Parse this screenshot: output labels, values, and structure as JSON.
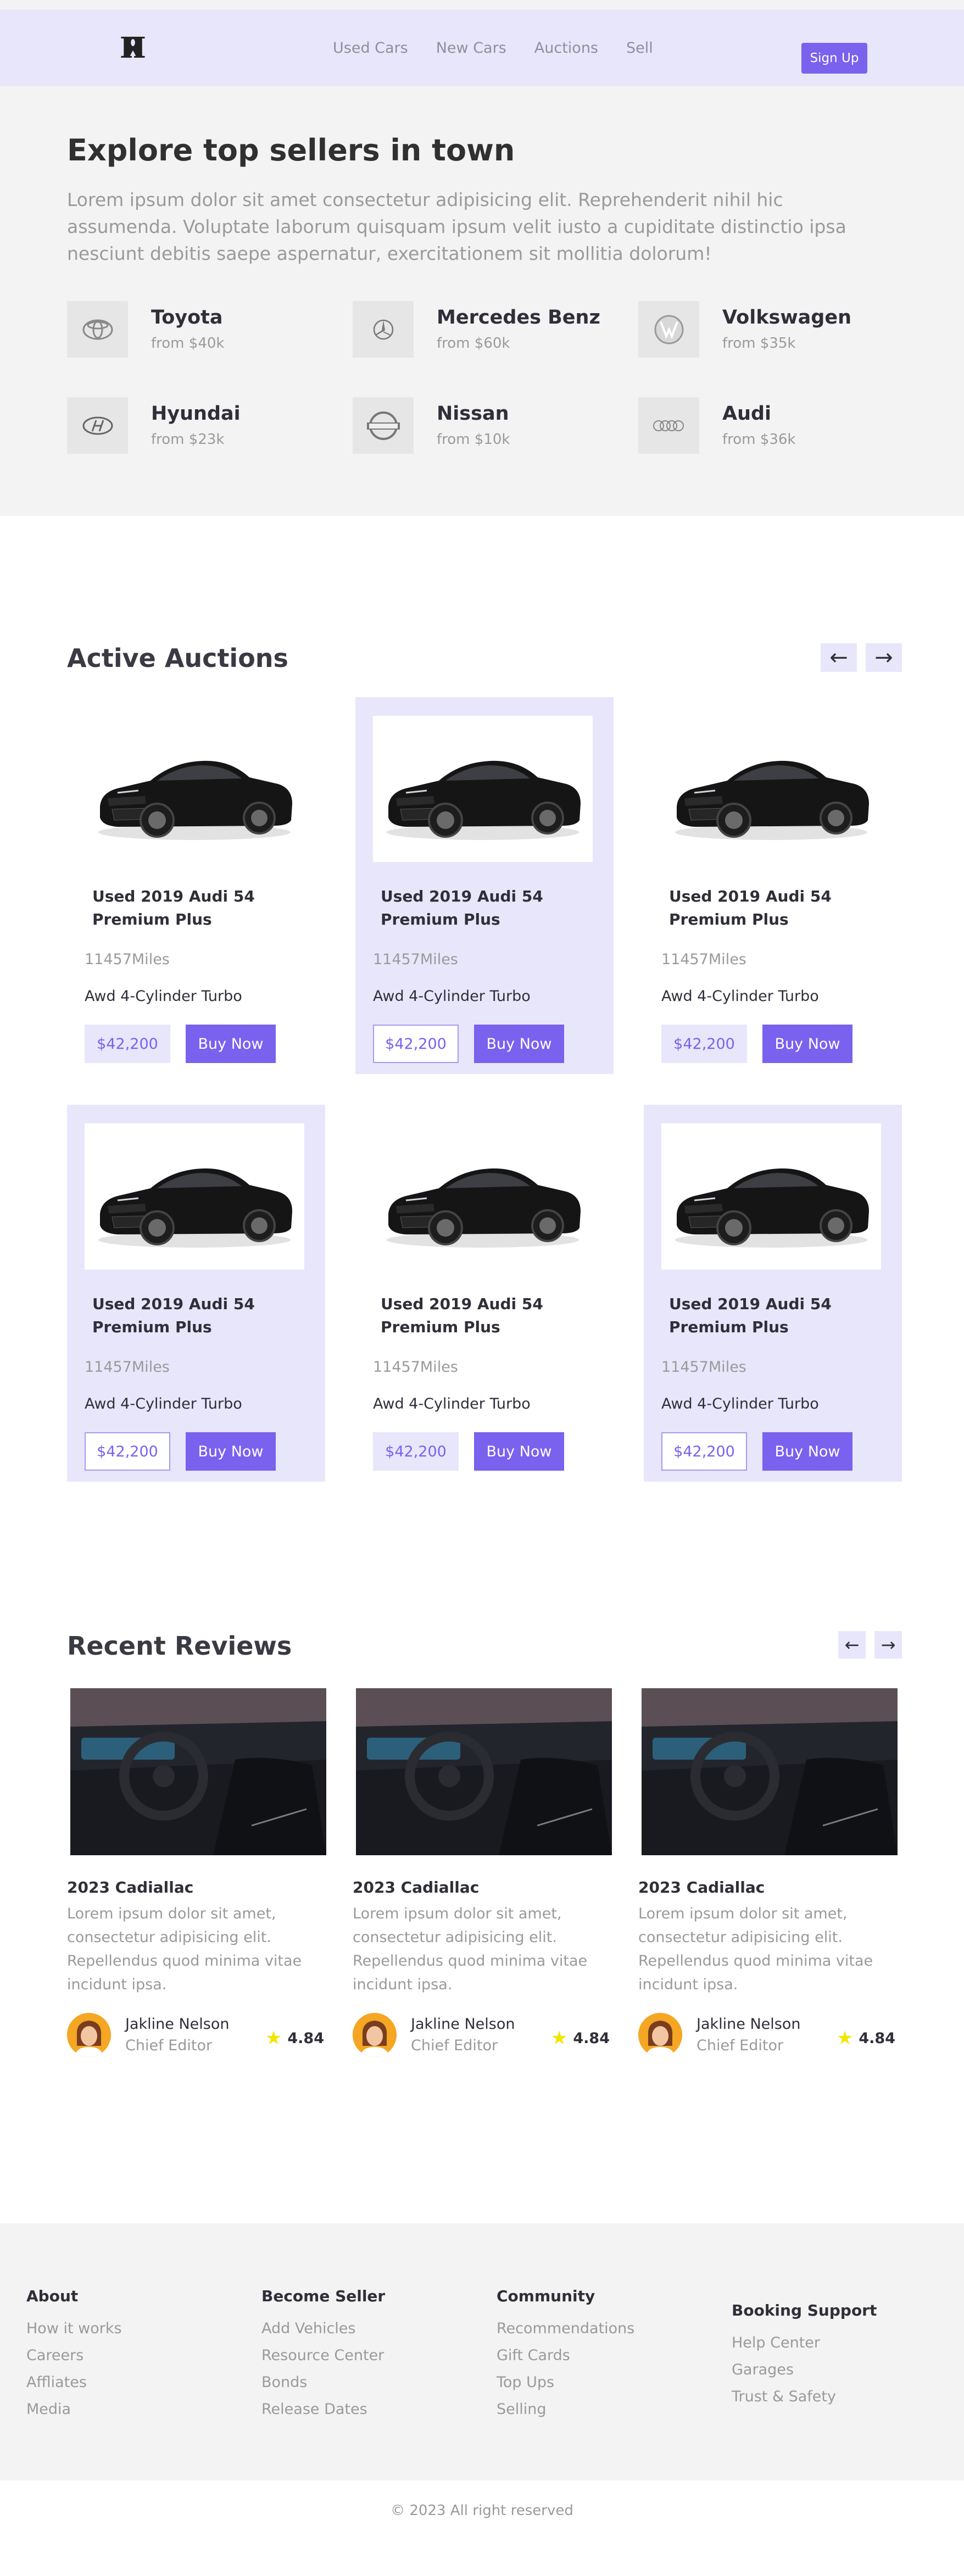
{
  "nav": {
    "links": [
      "Used Cars",
      "New Cars",
      "Auctions",
      "Sell"
    ],
    "signup_label": "Sign Up"
  },
  "sellers": {
    "title": "Explore top sellers in town",
    "lead": "Lorem ipsum dolor sit amet consectetur adipisicing elit. Reprehenderit nihil hic assumenda. Voluptate laborum quisquam ipsum velit iusto a cupiditate distinctio ipsa nesciunt debitis saepe aspernatur, exercitationem sit mollitia dolorum!",
    "brands": [
      {
        "name": "Toyota",
        "price": "from $40k",
        "icon": "toyota-logo-icon"
      },
      {
        "name": "Mercedes Benz",
        "price": "from $60k",
        "icon": "mercedes-logo-icon"
      },
      {
        "name": "Volkswagen",
        "price": "from $35k",
        "icon": "volkswagen-logo-icon"
      },
      {
        "name": "Hyundai",
        "price": "from $23k",
        "icon": "hyundai-logo-icon"
      },
      {
        "name": "Nissan",
        "price": "from $10k",
        "icon": "nissan-logo-icon"
      },
      {
        "name": "Audi",
        "price": "from $36k",
        "icon": "audi-logo-icon"
      }
    ]
  },
  "auctions": {
    "title": "Active Auctions",
    "prev_icon": "arrow-left-icon",
    "next_icon": "arrow-right-icon",
    "cards": [
      {
        "title": "Used 2019 Audi 54 Premium Plus",
        "miles": "11457Miles",
        "engine": "Awd 4-Cylinder Turbo",
        "price": "$42,200",
        "buy": "Buy Now",
        "highlighted": false
      },
      {
        "title": "Used 2019 Audi 54 Premium Plus",
        "miles": "11457Miles",
        "engine": "Awd 4-Cylinder Turbo",
        "price": "$42,200",
        "buy": "Buy Now",
        "highlighted": true
      },
      {
        "title": "Used 2019 Audi 54 Premium Plus",
        "miles": "11457Miles",
        "engine": "Awd 4-Cylinder Turbo",
        "price": "$42,200",
        "buy": "Buy Now",
        "highlighted": false
      },
      {
        "title": "Used 2019 Audi 54 Premium Plus",
        "miles": "11457Miles",
        "engine": "Awd 4-Cylinder Turbo",
        "price": "$42,200",
        "buy": "Buy Now",
        "highlighted": true
      },
      {
        "title": "Used 2019 Audi 54 Premium Plus",
        "miles": "11457Miles",
        "engine": "Awd 4-Cylinder Turbo",
        "price": "$42,200",
        "buy": "Buy Now",
        "highlighted": false
      },
      {
        "title": "Used 2019 Audi 54 Premium Plus",
        "miles": "11457Miles",
        "engine": "Awd 4-Cylinder Turbo",
        "price": "$42,200",
        "buy": "Buy Now",
        "highlighted": true
      }
    ]
  },
  "reviews": {
    "title": "Recent Reviews",
    "items": [
      {
        "title": "2023 Cadiallac",
        "text": "Lorem ipsum dolor sit amet, consectetur adipisicing elit. Repellendus quod minima vitae incidunt ipsa.",
        "name": "Jakline Nelson",
        "role": "Chief Editor",
        "rating": "4.84"
      },
      {
        "title": "2023 Cadiallac",
        "text": "Lorem ipsum dolor sit amet, consectetur adipisicing elit. Repellendus quod minima vitae incidunt ipsa.",
        "name": "Jakline Nelson",
        "role": "Chief Editor",
        "rating": "4.84"
      },
      {
        "title": "2023 Cadiallac",
        "text": "Lorem ipsum dolor sit amet, consectetur adipisicing elit. Repellendus quod minima vitae incidunt ipsa.",
        "name": "Jakline Nelson",
        "role": "Chief Editor",
        "rating": "4.84"
      }
    ]
  },
  "footer": {
    "columns": [
      {
        "heading": "About",
        "links": [
          "How it works",
          "Careers",
          "Affliates",
          "Media"
        ]
      },
      {
        "heading": "Become Seller",
        "links": [
          "Add Vehicles",
          "Resource Center",
          "Bonds",
          "Release Dates"
        ]
      },
      {
        "heading": "Community",
        "links": [
          "Recommendations",
          "Gift Cards",
          "Top Ups",
          "Selling"
        ]
      },
      {
        "heading": "Booking Support",
        "links": [
          "Help Center",
          "Garages",
          "Trust & Safety"
        ]
      }
    ],
    "copyright": "© 2023 All right reserved"
  },
  "colors": {
    "accent": "#7a61ee",
    "accent_light": "#e8e6fb",
    "muted": "#9a9a9a",
    "panel": "#f3f3f3"
  }
}
